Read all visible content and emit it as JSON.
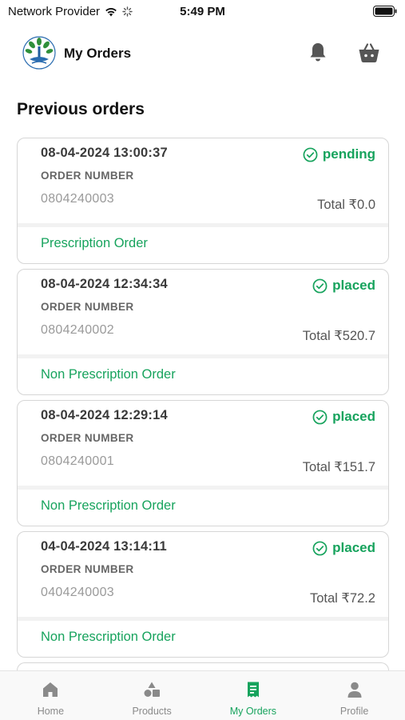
{
  "status_bar": {
    "carrier": "Network Provider",
    "time": "5:49 PM"
  },
  "header": {
    "title": "My Orders",
    "icons": [
      "app-logo",
      "bell-icon",
      "basket-icon"
    ]
  },
  "section_title": "Previous orders",
  "order_number_label": "ORDER NUMBER",
  "colors": {
    "accent": "#17a35d",
    "text_dark": "#3a3a3a",
    "text_muted": "#9a9a9a",
    "border": "#d6d6d6"
  },
  "orders": [
    {
      "datetime": "08-04-2024 13:00:37",
      "status": "pending",
      "order_number": "0804240003",
      "total": "Total ₹0.0",
      "type": "Prescription Order"
    },
    {
      "datetime": "08-04-2024 12:34:34",
      "status": "placed",
      "order_number": "0804240002",
      "total": "Total ₹520.7",
      "type": "Non Prescription Order"
    },
    {
      "datetime": "08-04-2024 12:29:14",
      "status": "placed",
      "order_number": "0804240001",
      "total": "Total ₹151.7",
      "type": "Non Prescription Order"
    },
    {
      "datetime": "04-04-2024 13:14:11",
      "status": "placed",
      "order_number": "0404240003",
      "total": "Total ₹72.2",
      "type": "Non Prescription Order"
    }
  ],
  "tabs": [
    {
      "label": "Home",
      "icon": "home-icon",
      "active": false
    },
    {
      "label": "Products",
      "icon": "shapes-icon",
      "active": false
    },
    {
      "label": "My Orders",
      "icon": "receipt-icon",
      "active": true
    },
    {
      "label": "Profile",
      "icon": "person-icon",
      "active": false
    }
  ]
}
